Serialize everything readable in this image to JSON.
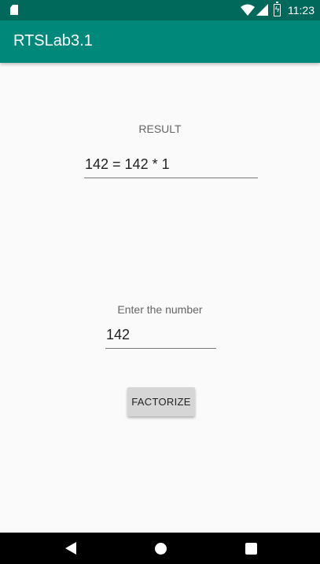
{
  "status_bar": {
    "time": "11:23",
    "icons": [
      "sd-card-icon",
      "wifi-icon",
      "signal-icon",
      "battery-charging-icon"
    ]
  },
  "app_bar": {
    "title": "RTSLab3.1"
  },
  "main": {
    "result_label": "RESULT",
    "result_value": "142 = 142 * 1",
    "input_label": "Enter the number",
    "input_value": "142",
    "factorize_label": "FACTORIZE"
  },
  "nav_bar": {
    "icons": [
      "back-icon",
      "home-icon",
      "recents-icon"
    ]
  },
  "colors": {
    "status_bar": "#00695c",
    "app_bar": "#00897b",
    "background": "#fafafa",
    "button": "#d6d6d6"
  }
}
